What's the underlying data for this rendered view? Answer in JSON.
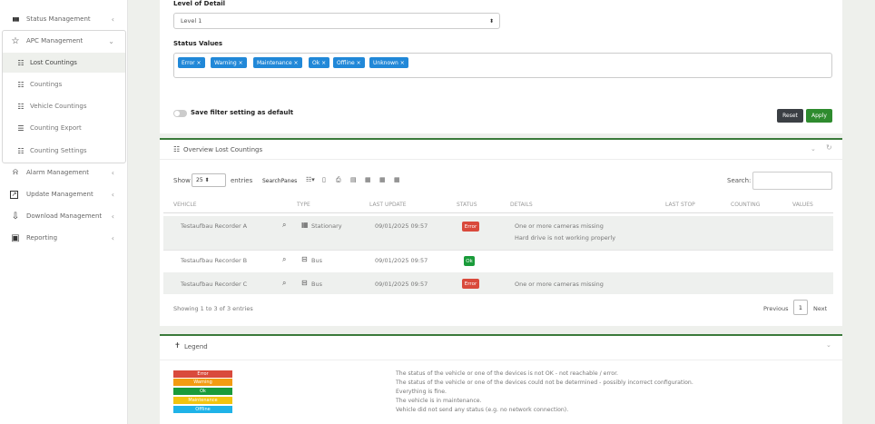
{
  "sidebar": {
    "items": [
      {
        "label": "Status Management",
        "icon": "bar-chart-icon",
        "glyph": "▮▮▮"
      },
      {
        "label": "APC Management",
        "icon": "star-icon",
        "glyph": "☆"
      },
      {
        "label": "Lost Countings",
        "icon": "list-icon",
        "glyph": "☷"
      },
      {
        "label": "Countings",
        "icon": "list-icon",
        "glyph": "☷"
      },
      {
        "label": "Vehicle Countings",
        "icon": "list-icon",
        "glyph": "☷"
      },
      {
        "label": "Counting Export",
        "icon": "list-icon",
        "glyph": "☰"
      },
      {
        "label": "Counting Settings",
        "icon": "list-icon",
        "glyph": "☷"
      },
      {
        "label": "Alarm Management",
        "icon": "bell-icon",
        "glyph": "🔔"
      },
      {
        "label": "Update Management",
        "icon": "external-link-icon",
        "glyph": "↗"
      },
      {
        "label": "Download Management",
        "icon": "download-icon",
        "glyph": "⇩"
      },
      {
        "label": "Reporting",
        "icon": "report-icon",
        "glyph": "▣"
      }
    ],
    "chevron": "‹",
    "chevron_open": "⌄"
  },
  "filter": {
    "level_label": "Level of Detail",
    "level_value": "Level 1",
    "select_arrow": "⬍",
    "status_label": "Status Values",
    "tags": [
      "Error ×",
      "Warning ×",
      "Maintenance ×",
      "Ok ×",
      "Offline ×",
      "Unknown ×"
    ],
    "save_label": "Save filter setting as default",
    "reset_label": "Reset",
    "apply_label": "Apply"
  },
  "overview": {
    "title_icon": "☷",
    "title": "Overview Lost Countings",
    "collapse_glyph": "⌄",
    "refresh_glyph": "↻",
    "show": "Show",
    "page_size": "25 ⬍",
    "entries": "entries",
    "searchpanes": "SearchPanes",
    "toolbar_glyphs": [
      "☷▾",
      "▯",
      "⎙",
      "▤",
      "▦",
      "▦",
      "▦"
    ],
    "search_label": "Search:",
    "search_value": "",
    "columns": [
      "Vehicle",
      "Type",
      "Last Update",
      "Status",
      "Details",
      "Last Stop",
      "Counting",
      "Values"
    ],
    "rows": [
      {
        "vehicle": "Testaufbau Recorder A",
        "type": "Stationary",
        "type_glyph": "▦",
        "updated": "09/01/2025 09:57",
        "status": "Error",
        "details": [
          "One or more cameras missing",
          "Hard drive is not working properly"
        ]
      },
      {
        "vehicle": "Testaufbau Recorder B",
        "type": "Bus",
        "type_glyph": "⊟",
        "updated": "09/01/2025 09:57",
        "status": "Ok",
        "details": [
          ""
        ]
      },
      {
        "vehicle": "Testaufbau Recorder C",
        "type": "Bus",
        "type_glyph": "⊟",
        "updated": "09/01/2025 09:57",
        "status": "Error",
        "details": [
          "One or more cameras missing"
        ]
      }
    ],
    "search_glyph": "⌕",
    "showing": "Showing 1 to 3 of 3 entries",
    "previous": "Previous",
    "page": "1",
    "next": "Next"
  },
  "legend": {
    "title_icon": "✝",
    "title": "Legend",
    "collapse_glyph": "⌄",
    "items": [
      {
        "label": "Error",
        "color": "#d94a3c",
        "text": "The status of the vehicle or one of the devices is not OK - not reachable / error."
      },
      {
        "label": "Warning",
        "color": "#f39c12",
        "text": "The status of the vehicle or one of the devices could not be determined - possibly incorrect configuration."
      },
      {
        "label": "Ok",
        "color": "#1a9b3a",
        "text": "Everything is fine."
      },
      {
        "label": "Maintenance",
        "color": "#f1c40f",
        "text": "The vehicle is in maintenance."
      },
      {
        "label": "Offline",
        "color": "#1fb3e8",
        "text": "Vehicle did not send any status (e.g. no network connection)."
      }
    ]
  },
  "colors": {
    "accent": "#3a7a3a",
    "tag": "#2188d8",
    "error": "#d94a3c",
    "ok": "#1a9b3a",
    "apply": "#2e8b2e",
    "reset": "#3b3f44"
  }
}
